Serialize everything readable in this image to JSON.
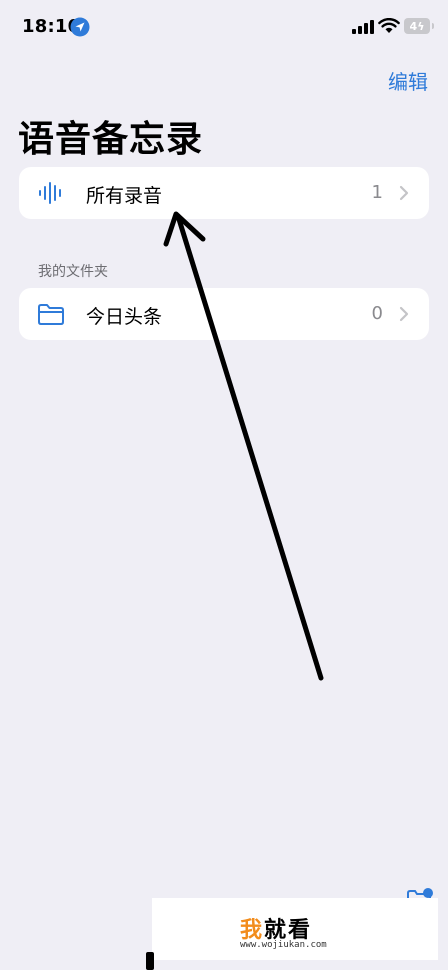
{
  "status_bar": {
    "time": "18:10",
    "battery": "4"
  },
  "header": {
    "edit_label": "编辑",
    "title": "语音备忘录"
  },
  "all_recordings": {
    "label": "所有录音",
    "count": "1"
  },
  "folders_section": {
    "header": "我的文件夹",
    "items": [
      {
        "label": "今日头条",
        "count": "0"
      }
    ]
  },
  "watermark": {
    "brand_first": "我",
    "brand_rest": "就看",
    "url": "www.wojiukan.com"
  },
  "colors": {
    "accent": "#2f7bd9",
    "background": "#efeef5",
    "card": "#ffffff",
    "secondary_text": "#8a8a8e",
    "annotation_arrow": "#000000"
  },
  "icons": {
    "location": "location-arrow-icon",
    "signal": "cellular-signal-icon",
    "wifi": "wifi-icon",
    "waveform": "waveform-icon",
    "folder": "folder-icon",
    "chevron": "chevron-right-icon",
    "new_folder": "new-folder-icon"
  }
}
